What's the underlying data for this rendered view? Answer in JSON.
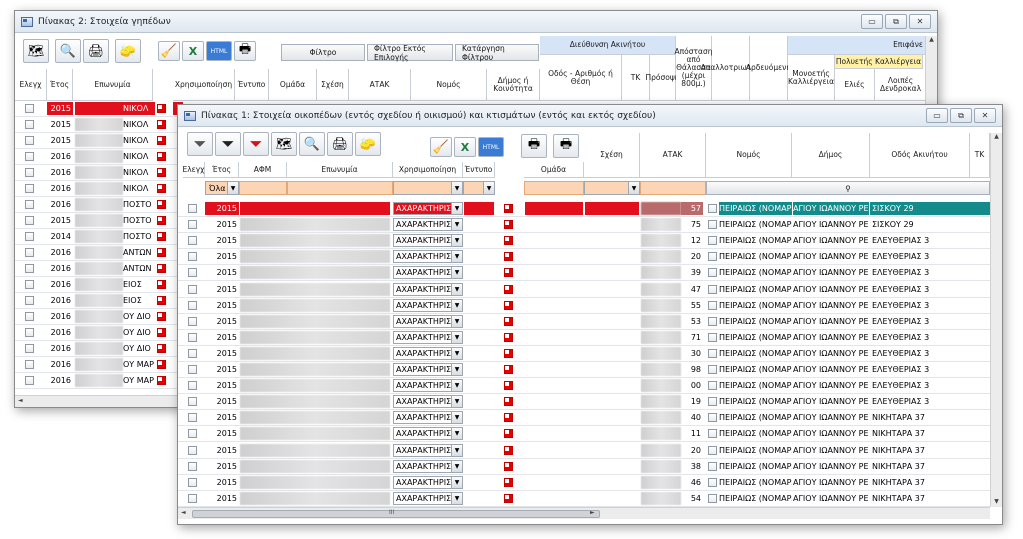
{
  "back_window": {
    "title": "Πίνακας 2: Στοιχεία γηπέδων",
    "buttons": {
      "filter": "Φίλτρο",
      "filter_except": "Φίλτρο Εκτός Επιλογής",
      "clear_filter": "Κατάργηση Φίλτρου"
    },
    "group_headers": {
      "address": "Διεύθυνση Ακινήτου",
      "surface": "Επιφάνε",
      "crops": "Πολυετής Καλλιέργεια"
    },
    "columns": [
      "Ελεγχ",
      "Έτος",
      "Επωνυμία",
      "Χρησιμοποίηση",
      "Έντυπο",
      "Ομάδα",
      "Σχέση",
      "ΑΤΑΚ",
      "Νομός",
      "Δήμος ή Κοινότητα",
      "Οδός - Αριθμός ή Θέση",
      "ΤΚ",
      "Πρόσοψη",
      "Απόσταση από Θάλασσα (μέχρι 800μ.)",
      "Απαλλοτριωτέα",
      "Αρδευόμενη",
      "Μονοετής Καλλιέργεια",
      "Ελιές",
      "Λοιπές Δενδροκαλ"
    ],
    "rows": [
      {
        "year": "2015",
        "name": "ΝΙΚΟΛ"
      },
      {
        "year": "2015",
        "name": "ΝΙΚΟΛ"
      },
      {
        "year": "2015",
        "name": "ΝΙΚΟΛ"
      },
      {
        "year": "2016",
        "name": "ΝΙΚΟΛ"
      },
      {
        "year": "2016",
        "name": "ΝΙΚΟΛ"
      },
      {
        "year": "2016",
        "name": "ΝΙΚΟΛ"
      },
      {
        "year": "2016",
        "name": "ΠΟΣΤΟ"
      },
      {
        "year": "2015",
        "name": "ΠΟΣΤΟ"
      },
      {
        "year": "2014",
        "name": "ΠΟΣΤΟ"
      },
      {
        "year": "2016",
        "name": "ΑΝΤΩΝ"
      },
      {
        "year": "2016",
        "name": "ΑΝΤΩΝ"
      },
      {
        "year": "2016",
        "name": "ΕΙΟΣ"
      },
      {
        "year": "2016",
        "name": "ΕΙΟΣ"
      },
      {
        "year": "2016",
        "name": "ΟΥ ΔΙΟ"
      },
      {
        "year": "2016",
        "name": "ΟΥ ΔΙΟ"
      },
      {
        "year": "2016",
        "name": "ΟΥ ΔΙΟ"
      },
      {
        "year": "2016",
        "name": "ΟΥ ΜΑΡ"
      },
      {
        "year": "2016",
        "name": "ΟΥ ΜΑΡ"
      }
    ]
  },
  "front_window": {
    "title": "Πίνακας 1: Στοιχεία οικοπέδων (εντός σχεδίου ή οικισμού) και κτισμάτων (εντός και εκτός σχεδίου)",
    "columns": [
      "Ελεγχ",
      "Έτος",
      "ΑΦΜ",
      "Επωνυμία",
      "Χρησιμοποίηση",
      "Έντυπο",
      "Ομάδα",
      "Σχέση",
      "ΑΤΑΚ",
      "Νομός",
      "Δήμος",
      "Οδός Ακινήτου",
      "ΤΚ"
    ],
    "year_filter": "Όλα",
    "rows": [
      {
        "year": "2015",
        "use": "ΑΧΑΡΑΚΤΗΡΙΣΤ",
        "atak": "57",
        "nomos": "ΠΕΙΡΑΙΩΣ (ΝΟΜΑΡΧ",
        "dimos": "ΑΓΙΟΥ ΙΩΑΝΝΟΥ ΡΕ",
        "odos": "ΣΙΣΚΟΥ 29"
      },
      {
        "year": "2015",
        "use": "ΑΧΑΡΑΚΤΗΡΙΣΤ",
        "atak": "75",
        "nomos": "ΠΕΙΡΑΙΩΣ (ΝΟΜΑΡΧ",
        "dimos": "ΑΓΙΟΥ ΙΩΑΝΝΟΥ ΡΕ",
        "odos": "ΣΙΣΚΟΥ 29"
      },
      {
        "year": "2015",
        "use": "ΑΧΑΡΑΚΤΗΡΙΣΤ",
        "atak": "12",
        "nomos": "ΠΕΙΡΑΙΩΣ (ΝΟΜΑΡΧ",
        "dimos": "ΑΓΙΟΥ ΙΩΑΝΝΟΥ ΡΕ",
        "odos": "ΕΛΕΥΘΕΡΙΑΣ 3"
      },
      {
        "year": "2015",
        "use": "ΑΧΑΡΑΚΤΗΡΙΣΤ",
        "atak": "20",
        "nomos": "ΠΕΙΡΑΙΩΣ (ΝΟΜΑΡΧ",
        "dimos": "ΑΓΙΟΥ ΙΩΑΝΝΟΥ ΡΕ",
        "odos": "ΕΛΕΥΘΕΡΙΑΣ 3"
      },
      {
        "year": "2015",
        "use": "ΑΧΑΡΑΚΤΗΡΙΣΤ",
        "atak": "39",
        "nomos": "ΠΕΙΡΑΙΩΣ (ΝΟΜΑΡΧ",
        "dimos": "ΑΓΙΟΥ ΙΩΑΝΝΟΥ ΡΕ",
        "odos": "ΕΛΕΥΘΕΡΙΑΣ 3"
      },
      {
        "year": "2015",
        "use": "ΑΧΑΡΑΚΤΗΡΙΣΤ",
        "atak": "47",
        "nomos": "ΠΕΙΡΑΙΩΣ (ΝΟΜΑΡΧ",
        "dimos": "ΑΓΙΟΥ ΙΩΑΝΝΟΥ ΡΕ",
        "odos": "ΕΛΕΥΘΕΡΙΑΣ 3"
      },
      {
        "year": "2015",
        "use": "ΑΧΑΡΑΚΤΗΡΙΣΤ",
        "atak": "55",
        "nomos": "ΠΕΙΡΑΙΩΣ (ΝΟΜΑΡΧ",
        "dimos": "ΑΓΙΟΥ ΙΩΑΝΝΟΥ ΡΕ",
        "odos": "ΕΛΕΥΘΕΡΙΑΣ 3"
      },
      {
        "year": "2015",
        "use": "ΑΧΑΡΑΚΤΗΡΙΣΤ",
        "atak": "53",
        "nomos": "ΠΕΙΡΑΙΩΣ (ΝΟΜΑΡΧ",
        "dimos": "ΑΓΙΟΥ ΙΩΑΝΝΟΥ ΡΕ",
        "odos": "ΕΛΕΥΘΕΡΙΑΣ 3"
      },
      {
        "year": "2015",
        "use": "ΑΧΑΡΑΚΤΗΡΙΣΤ",
        "atak": "71",
        "nomos": "ΠΕΙΡΑΙΩΣ (ΝΟΜΑΡΧ",
        "dimos": "ΑΓΙΟΥ ΙΩΑΝΝΟΥ ΡΕ",
        "odos": "ΕΛΕΥΘΕΡΙΑΣ 3"
      },
      {
        "year": "2015",
        "use": "ΑΧΑΡΑΚΤΗΡΙΣΤ",
        "atak": "30",
        "nomos": "ΠΕΙΡΑΙΩΣ (ΝΟΜΑΡΧ",
        "dimos": "ΑΓΙΟΥ ΙΩΑΝΝΟΥ ΡΕ",
        "odos": "ΕΛΕΥΘΕΡΙΑΣ 3"
      },
      {
        "year": "2015",
        "use": "ΑΧΑΡΑΚΤΗΡΙΣΤ",
        "atak": "98",
        "nomos": "ΠΕΙΡΑΙΩΣ (ΝΟΜΑΡΧ",
        "dimos": "ΑΓΙΟΥ ΙΩΑΝΝΟΥ ΡΕ",
        "odos": "ΕΛΕΥΘΕΡΙΑΣ 3"
      },
      {
        "year": "2015",
        "use": "ΑΧΑΡΑΚΤΗΡΙΣΤ",
        "atak": "00",
        "nomos": "ΠΕΙΡΑΙΩΣ (ΝΟΜΑΡΧ",
        "dimos": "ΑΓΙΟΥ ΙΩΑΝΝΟΥ ΡΕ",
        "odos": "ΕΛΕΥΘΕΡΙΑΣ 3"
      },
      {
        "year": "2015",
        "use": "ΑΧΑΡΑΚΤΗΡΙΣΤ",
        "atak": "19",
        "nomos": "ΠΕΙΡΑΙΩΣ (ΝΟΜΑΡΧ",
        "dimos": "ΑΓΙΟΥ ΙΩΑΝΝΟΥ ΡΕ",
        "odos": "ΕΛΕΥΘΕΡΙΑΣ 3"
      },
      {
        "year": "2015",
        "use": "ΑΧΑΡΑΚΤΗΡΙΣΤ",
        "atak": "40",
        "nomos": "ΠΕΙΡΑΙΩΣ (ΝΟΜΑΡΧ",
        "dimos": "ΑΓΙΟΥ ΙΩΑΝΝΟΥ ΡΕ",
        "odos": "ΝΙΚΗΤΑΡΑ 37"
      },
      {
        "year": "2015",
        "use": "ΑΧΑΡΑΚΤΗΡΙΣΤ",
        "atak": "11",
        "nomos": "ΠΕΙΡΑΙΩΣ (ΝΟΜΑΡΧ",
        "dimos": "ΑΓΙΟΥ ΙΩΑΝΝΟΥ ΡΕ",
        "odos": "ΝΙΚΗΤΑΡΑ 37"
      },
      {
        "year": "2015",
        "use": "ΑΧΑΡΑΚΤΗΡΙΣΤ",
        "atak": "20",
        "nomos": "ΠΕΙΡΑΙΩΣ (ΝΟΜΑΡΧ",
        "dimos": "ΑΓΙΟΥ ΙΩΑΝΝΟΥ ΡΕ",
        "odos": "ΝΙΚΗΤΑΡΑ 37"
      },
      {
        "year": "2015",
        "use": "ΑΧΑΡΑΚΤΗΡΙΣΤ",
        "atak": "38",
        "nomos": "ΠΕΙΡΑΙΩΣ (ΝΟΜΑΡΧ",
        "dimos": "ΑΓΙΟΥ ΙΩΑΝΝΟΥ ΡΕ",
        "odos": "ΝΙΚΗΤΑΡΑ 37"
      },
      {
        "year": "2015",
        "use": "ΑΧΑΡΑΚΤΗΡΙΣΤ",
        "atak": "46",
        "nomos": "ΠΕΙΡΑΙΩΣ (ΝΟΜΑΡΧ",
        "dimos": "ΑΓΙΟΥ ΙΩΑΝΝΟΥ ΡΕ",
        "odos": "ΝΙΚΗΤΑΡΑ 37"
      },
      {
        "year": "2015",
        "use": "ΑΧΑΡΑΚΤΗΡΙΣΤ",
        "atak": "54",
        "nomos": "ΠΕΙΡΑΙΩΣ (ΝΟΜΑΡΧ",
        "dimos": "ΑΓΙΟΥ ΙΩΑΝΝΟΥ ΡΕ",
        "odos": "ΝΙΚΗΤΑΡΑ 37"
      }
    ]
  },
  "window_controls": {
    "minimize": "▭",
    "restore": "⧉",
    "close": "✕"
  },
  "glyphs": {
    "dropdown": "▼",
    "scroll_up": "▲",
    "scroll_down": "▼",
    "scroll_left": "◄",
    "scroll_right": "►",
    "grip": "III",
    "lock": "⚲"
  },
  "tool_icons": {
    "map": "🗺",
    "search": "🔍",
    "print_preview": "🖨",
    "eraser": "🧽",
    "broom": "🧹",
    "excel": "X",
    "html": "HTML",
    "printer": "🖶",
    "funnel": "⏷"
  },
  "colors": {
    "selected_red": "#e2101c",
    "selected_teal": "#138b8b",
    "filter_orange": "#fcd5b4",
    "group_blue": "#d6e4f7",
    "group_yellow": "#fff2a8"
  }
}
